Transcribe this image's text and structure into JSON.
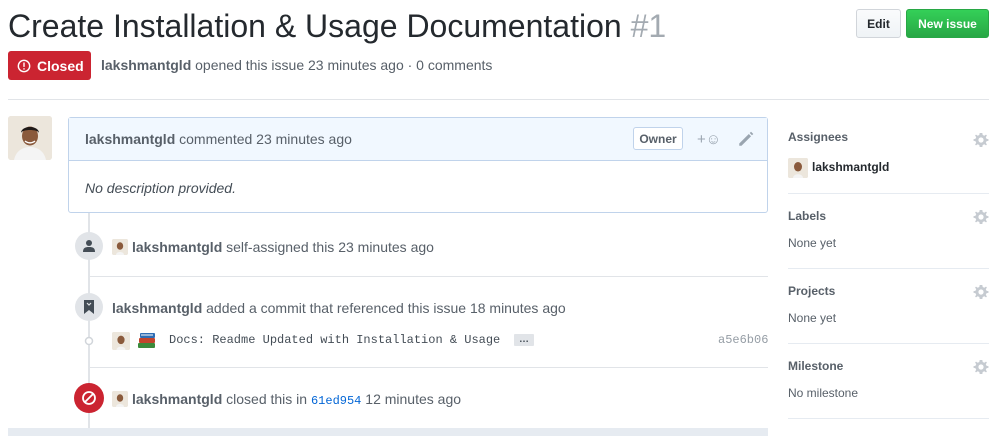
{
  "header": {
    "title": "Create Installation & Usage Documentation",
    "number": "#1",
    "edit_label": "Edit",
    "new_issue_label": "New issue"
  },
  "status": {
    "label": "Closed",
    "color": "#cb2431"
  },
  "meta": {
    "author": "lakshmantgld",
    "text": " opened this issue 23 minutes ago · 0 comments"
  },
  "comment": {
    "author": "lakshmantgld",
    "text": " commented 23 minutes ago",
    "owner_badge": "Owner",
    "reaction": "+☺",
    "body": "No description provided."
  },
  "timeline": {
    "assigned": {
      "author": "lakshmantgld",
      "text": " self-assigned this 23 minutes ago"
    },
    "commit_ref": {
      "author": "lakshmantgld",
      "text": " added a commit that referenced this issue 18 minutes ago",
      "commit_message": "Docs: Readme Updated with Installation & Usage",
      "ellipsis": "…",
      "sha": "a5e6b06"
    },
    "closed": {
      "author": "lakshmantgld",
      "text_before": " closed this in ",
      "sha_link": "61ed954",
      "text_after": " 12 minutes ago"
    }
  },
  "sidebar": {
    "assignees": {
      "title": "Assignees",
      "value": "lakshmantgld"
    },
    "labels": {
      "title": "Labels",
      "value": "None yet"
    },
    "projects": {
      "title": "Projects",
      "value": "None yet"
    },
    "milestone": {
      "title": "Milestone",
      "value": "No milestone"
    }
  },
  "colors": {
    "accent_green": "#28a745",
    "link_blue": "#0366d6",
    "closed_red": "#cb2431"
  }
}
